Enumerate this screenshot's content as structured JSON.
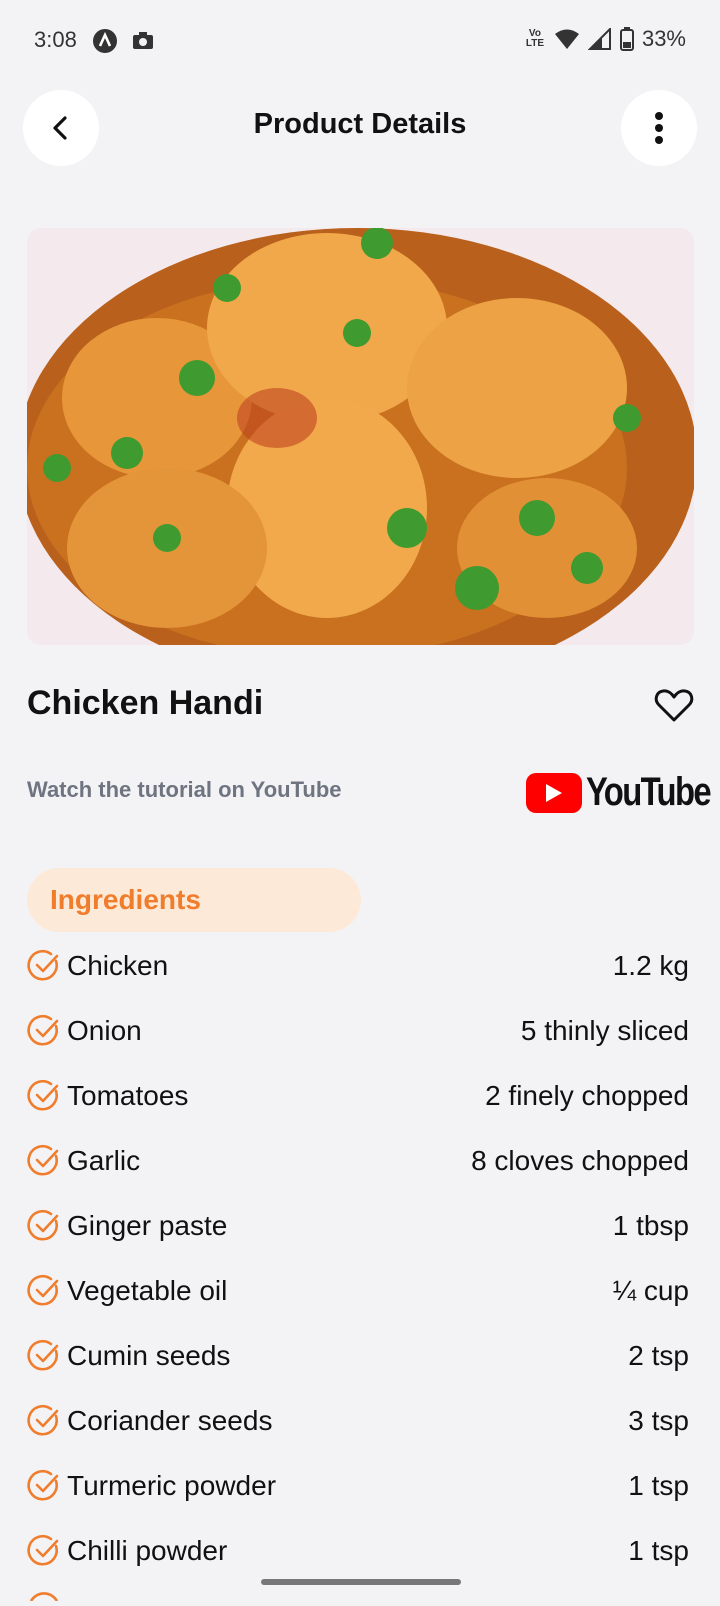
{
  "status": {
    "time": "3:08",
    "left_icons": [
      "notification-a-icon",
      "camera-icon"
    ],
    "network": "VoLTE",
    "battery": "33%"
  },
  "header": {
    "title": "Product Details",
    "back_icon": "chevron-left-icon",
    "more_icon": "more-vertical-icon"
  },
  "recipe": {
    "name": "Chicken Handi",
    "favorite_icon": "heart-outline-icon",
    "tutorial_text": "Watch the tutorial on YouTube",
    "youtube_logo_text": "YouTube"
  },
  "ingredients": {
    "heading": "Ingredients",
    "items": [
      {
        "name": "Chicken",
        "qty": "1.2 kg"
      },
      {
        "name": "Onion",
        "qty": "5 thinly sliced"
      },
      {
        "name": "Tomatoes",
        "qty": "2 finely chopped"
      },
      {
        "name": "Garlic",
        "qty": "8 cloves chopped"
      },
      {
        "name": "Ginger paste",
        "qty": "1 tbsp"
      },
      {
        "name": "Vegetable oil",
        "qty": "¼ cup"
      },
      {
        "name": "Cumin seeds",
        "qty": "2 tsp"
      },
      {
        "name": "Coriander seeds",
        "qty": "3 tsp"
      },
      {
        "name": "Turmeric powder",
        "qty": "1 tsp"
      },
      {
        "name": "Chilli powder",
        "qty": "1 tsp"
      }
    ]
  },
  "colors": {
    "accent": "#f07d2c",
    "chip_bg": "#fde9d8",
    "background": "#f3f3f6",
    "youtube_red": "#ff0000"
  }
}
